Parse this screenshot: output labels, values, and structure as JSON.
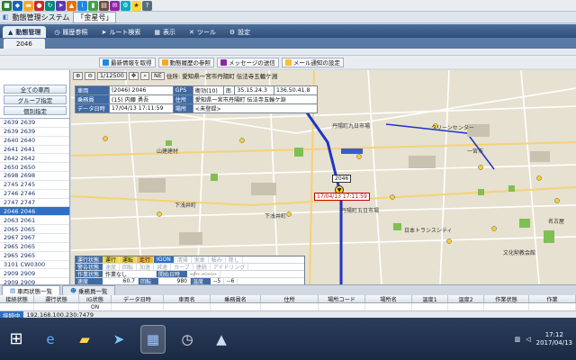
{
  "titlebar": {
    "app_title": "動態管理システム",
    "user": "「金星号」"
  },
  "menu": {
    "tabs": [
      "動態管理",
      "履歴参照",
      "ルート検索",
      "表示",
      "ツール",
      "設定"
    ]
  },
  "subtab": {
    "label": "2046"
  },
  "actions": {
    "buttons": [
      "最新情報を取得",
      "動態履歴の参照",
      "メッセージの送信",
      "メール通知の設定"
    ]
  },
  "left_panel": {
    "buttons": [
      "全ての車両",
      "グループ指定",
      "個別指定"
    ],
    "vehicles": [
      "2639 2639",
      "2639 2639",
      "2640 2640",
      "2641 2641",
      "2642 2642",
      "2650 2650",
      "2698 2698",
      "2745 2745",
      "2746 2746",
      "2747 2747",
      "2046 2046",
      "2063 2061",
      "2065 2065",
      "2967 2967",
      "2965 2065",
      "2965 2965",
      "3101 CW0300",
      "2909 2909",
      "2909 2909",
      "2941 2941"
    ],
    "selected_index": 10
  },
  "map_controls": {
    "scale": "1/12500",
    "ne": "NE",
    "address_label": "住所:",
    "address": "愛知県一宮市丹陽町 伝法寺五輪ケ淵"
  },
  "info": {
    "vehicle_label": "車両",
    "vehicle": "(2046) 2046",
    "gps_label": "GPS",
    "gps": "衛効(10)",
    "dir": "南",
    "lat": "35.15.24.3",
    "lon": "136.50.41.8",
    "driver_label": "乗務員",
    "driver": "(15) 内藤 勇吾",
    "addr_label": "住所",
    "addr": "愛知県一宮市丹陽町 伝法寺五輪ケ淵",
    "time_label": "データ日時",
    "time": "17/04/13 17:11:59",
    "place_label": "場所",
    "place": "<未登録>"
  },
  "vehicle_marker": {
    "label": "17/04/13 17:11:59",
    "id": "2046"
  },
  "status_panel": {
    "row1_label": "運行状態",
    "row1": [
      "運行",
      "運転",
      "走行",
      "IGON",
      "清掃",
      "実車",
      "積み",
      "降し"
    ],
    "row2_label": "警告状態",
    "row2": [
      "速度",
      "回転",
      "加速",
      "減速",
      "カーブ",
      "連続",
      "アイドリング"
    ],
    "row3_label": "作業状態",
    "row3_value": "作業なし",
    "row3_extra_label": "開始日時",
    "row3_extra": "--/-- --:--:--",
    "row4_label": "速度",
    "speed": "60.7",
    "rpm_label": "回転",
    "rpm": "980",
    "temp_label": "温度",
    "temp1": "--5",
    "temp2": "--6"
  },
  "bottom_tabs": [
    "車両状態一覧",
    "乗務員一覧"
  ],
  "grid": {
    "headers": [
      "接続状態",
      "運行状態",
      "IG状態",
      "データ日時",
      "車両名",
      "乗務員名",
      "住所",
      "場所コード",
      "場所名",
      "温度1",
      "温度2",
      "作業状態",
      "作業"
    ],
    "row": [
      "",
      "",
      "ON",
      "",
      "",
      "",
      "",
      "",
      "",
      "",
      "",
      "",
      ""
    ]
  },
  "statusbar": {
    "conn": "接続中",
    "ip": "192.168.100.230:7479"
  },
  "taskbar": {
    "time": "17:12",
    "date": "2017/04/13"
  },
  "colors": {
    "accent": "#2f6fc5",
    "header": "#3f6aa4",
    "route": "#1f35c9"
  }
}
